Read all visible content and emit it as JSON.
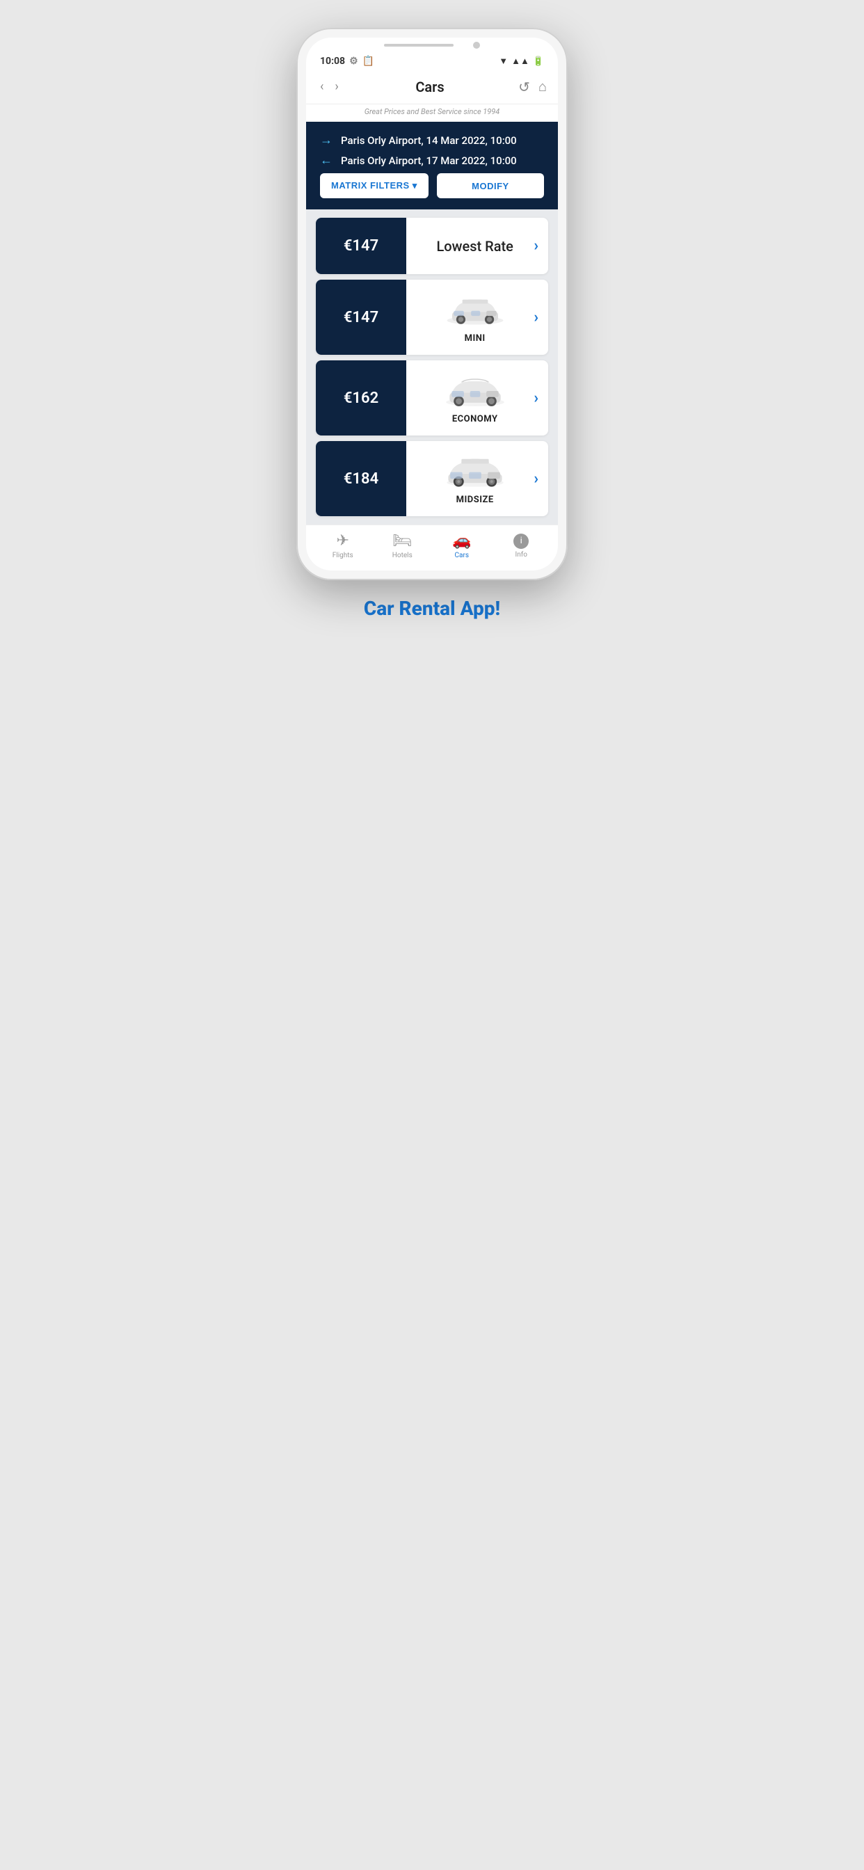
{
  "status": {
    "time": "10:08",
    "wifi_icon": "▲",
    "signal_icon": "▲▲",
    "battery_icon": "▐"
  },
  "nav": {
    "back_label": "‹",
    "forward_label": "›",
    "title": "Cars",
    "refresh_label": "↺",
    "home_label": "⌂"
  },
  "subtitle": "Great Prices and Best Service since 1994",
  "search": {
    "pickup_arrow": "→",
    "pickup_text": "Paris Orly Airport, 14 Mar 2022, 10:00",
    "dropoff_arrow": "←",
    "dropoff_text": "Paris Orly Airport, 17 Mar 2022, 10:00",
    "matrix_btn": "MATRIX FILTERS ▾",
    "modify_btn": "MODIFY"
  },
  "cars": [
    {
      "price": "€147",
      "label": "Lowest Rate",
      "type": "lowest_rate"
    },
    {
      "price": "€147",
      "label": "MINI",
      "type": "mini"
    },
    {
      "price": "€162",
      "label": "ECONOMY",
      "type": "economy"
    },
    {
      "price": "€184",
      "label": "MIDSIZE",
      "type": "midsize"
    }
  ],
  "bottom_nav": [
    {
      "icon": "✈",
      "label": "Flights",
      "active": false
    },
    {
      "icon": "🛏",
      "label": "Hotels",
      "active": false
    },
    {
      "icon": "🚗",
      "label": "Cars",
      "active": true
    },
    {
      "icon": "ℹ",
      "label": "Info",
      "active": false
    }
  ],
  "footer": "Car Rental App!"
}
